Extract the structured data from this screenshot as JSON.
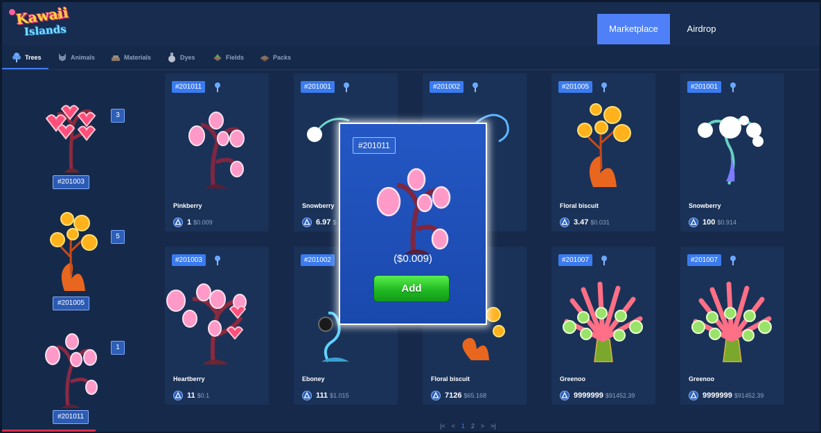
{
  "app": {
    "logo_line1": "Kawaii",
    "logo_line2": "Islands"
  },
  "nav": {
    "marketplace_label": "Marketplace",
    "airdrop_label": "Airdrop"
  },
  "tabs": [
    {
      "label": "Trees",
      "icon": "tree-icon",
      "active": true
    },
    {
      "label": "Animals",
      "icon": "animal-icon",
      "active": false
    },
    {
      "label": "Materials",
      "icon": "materials-icon",
      "active": false
    },
    {
      "label": "Dyes",
      "icon": "dye-bottle-icon",
      "active": false
    },
    {
      "label": "Fields",
      "icon": "field-icon",
      "active": false
    },
    {
      "label": "Packs",
      "icon": "pack-icon",
      "active": false
    }
  ],
  "sidebar": {
    "items": [
      {
        "count": "3",
        "id": "#201003"
      },
      {
        "count": "5",
        "id": "#201005"
      },
      {
        "count": "1",
        "id": "#201011"
      }
    ]
  },
  "listings": [
    {
      "id": "#201011",
      "name": "Pinkberry",
      "qty": "1",
      "usd": "$0.009",
      "kind": "pinkberry"
    },
    {
      "id": "#201001",
      "name": "Snowberry",
      "qty": "6.97",
      "usd": "$",
      "kind": "snowberry"
    },
    {
      "id": "#201002",
      "name": "",
      "qty": "",
      "usd": "",
      "kind": "blue"
    },
    {
      "id": "#201005",
      "name": "Floral biscuit",
      "qty": "3.47",
      "usd": "$0.031",
      "kind": "floral"
    },
    {
      "id": "#201001",
      "name": "Snowberry",
      "qty": "100",
      "usd": "$0.914",
      "kind": "snowberry"
    },
    {
      "id": "#201003",
      "name": "Heartberry",
      "qty": "11",
      "usd": "$0.1",
      "kind": "heartberry"
    },
    {
      "id": "#201002",
      "name": "Eboney",
      "qty": "111",
      "usd": "$1.015",
      "kind": "eboney"
    },
    {
      "id": "",
      "name": "Floral biscuit",
      "qty": "7126",
      "usd": "$65.168",
      "kind": "floral"
    },
    {
      "id": "#201007",
      "name": "Greenoo",
      "qty": "9999999",
      "usd": "$91452.39",
      "kind": "greenoo"
    },
    {
      "id": "#201007",
      "name": "Greenoo",
      "qty": "9999999",
      "usd": "$91452.39",
      "kind": "greenoo"
    }
  ],
  "modal": {
    "id": "#201011",
    "price": "($0.009)",
    "add_label": "Add"
  },
  "pagination": {
    "first": "|<",
    "prev": "<",
    "page1": "1",
    "page2": "2",
    "next": ">",
    "last": ">|"
  },
  "colors": {
    "accent": "#4f80f7",
    "add_button": "#21b923",
    "badge": "#3b7bf0"
  }
}
